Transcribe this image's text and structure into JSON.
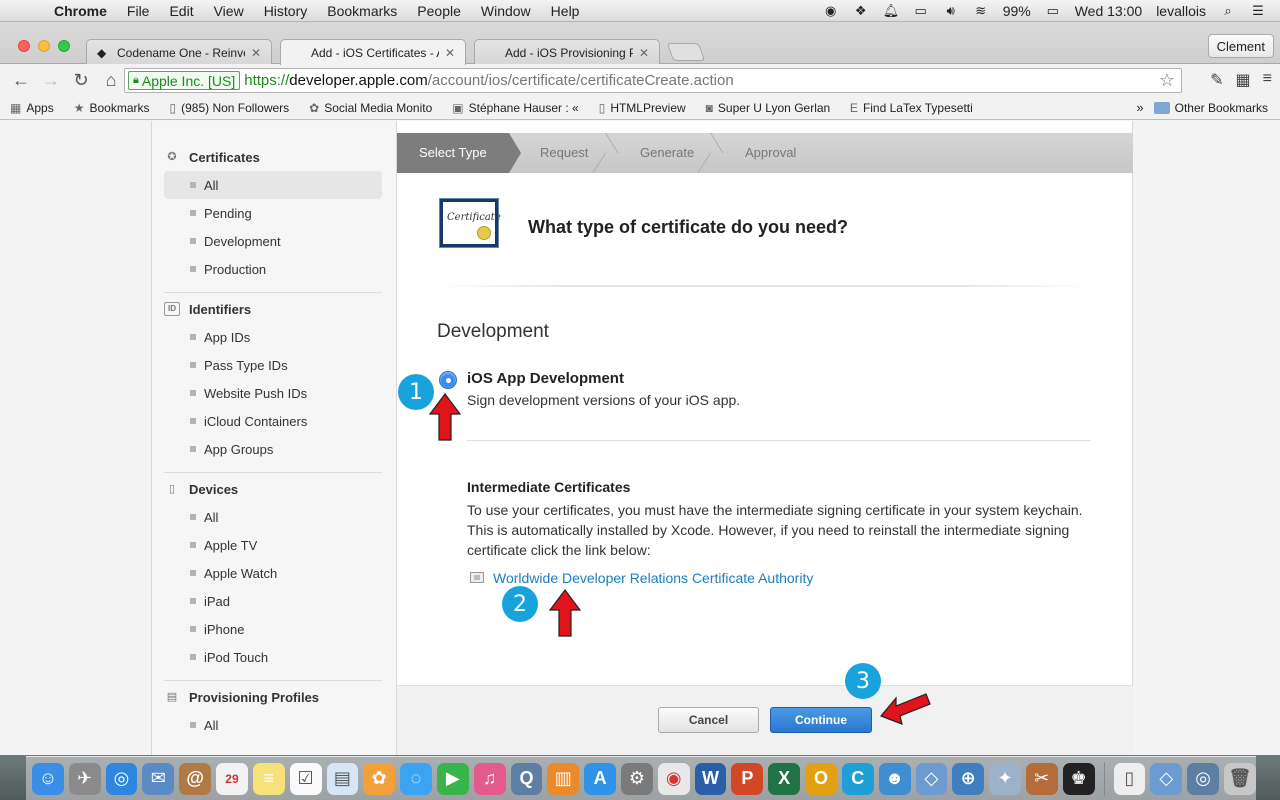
{
  "menubar": {
    "app": "Chrome",
    "items": [
      "File",
      "Edit",
      "View",
      "History",
      "Bookmarks",
      "People",
      "Window",
      "Help"
    ],
    "battery": "99%",
    "clock": "Wed 13:00",
    "user": "levallois"
  },
  "tabs": [
    {
      "title": "Codename One - Reinvent"
    },
    {
      "title": "Add - iOS Certificates - Ap"
    },
    {
      "title": "Add - iOS Provisioning Pro"
    }
  ],
  "profile": "Clement",
  "omnibox": {
    "ev_label": "Apple Inc. [US]",
    "scheme": "https://",
    "host": "developer.apple.com",
    "path": "/account/ios/certificate/certificateCreate.action"
  },
  "bookmarks": {
    "items": [
      "Apps",
      "Bookmarks",
      "(985) Non Followers",
      "Social Media Monito",
      "Stéphane Hauser : «",
      "HTMLPreview",
      "Super U Lyon Gerlan",
      "Find LaTex Typesetti"
    ],
    "more": "»",
    "other": "Other Bookmarks"
  },
  "sidebar": {
    "certificates": {
      "title": "Certificates",
      "items": [
        "All",
        "Pending",
        "Development",
        "Production"
      ]
    },
    "identifiers": {
      "title": "Identifiers",
      "items": [
        "App IDs",
        "Pass Type IDs",
        "Website Push IDs",
        "iCloud Containers",
        "App Groups"
      ]
    },
    "devices": {
      "title": "Devices",
      "items": [
        "All",
        "Apple TV",
        "Apple Watch",
        "iPad",
        "iPhone",
        "iPod Touch"
      ]
    },
    "profiles": {
      "title": "Provisioning Profiles",
      "items": [
        "All"
      ]
    }
  },
  "steps": [
    "Select Type",
    "Request",
    "Generate",
    "Approval"
  ],
  "main": {
    "cert_icon_text": "Certificate",
    "question": "What type of certificate do you need?",
    "section": "Development",
    "option_title": "iOS App Development",
    "option_desc": "Sign development versions of your iOS app.",
    "inter_title": "Intermediate Certificates",
    "inter_text": "To use your certificates, you must have the intermediate signing certificate in your system keychain. This is automatically installed by Xcode. However, if you need to reinstall the intermediate signing certificate click the link below:",
    "link": "Worldwide Developer Relations Certificate Authority",
    "cancel": "Cancel",
    "continue": "Continue"
  },
  "annotations": [
    "1",
    "2",
    "3"
  ],
  "colors": {
    "accent": "#2a78cf",
    "badge": "#18a3dd",
    "arrow": "#e0141a",
    "link": "#1a7fc1"
  }
}
